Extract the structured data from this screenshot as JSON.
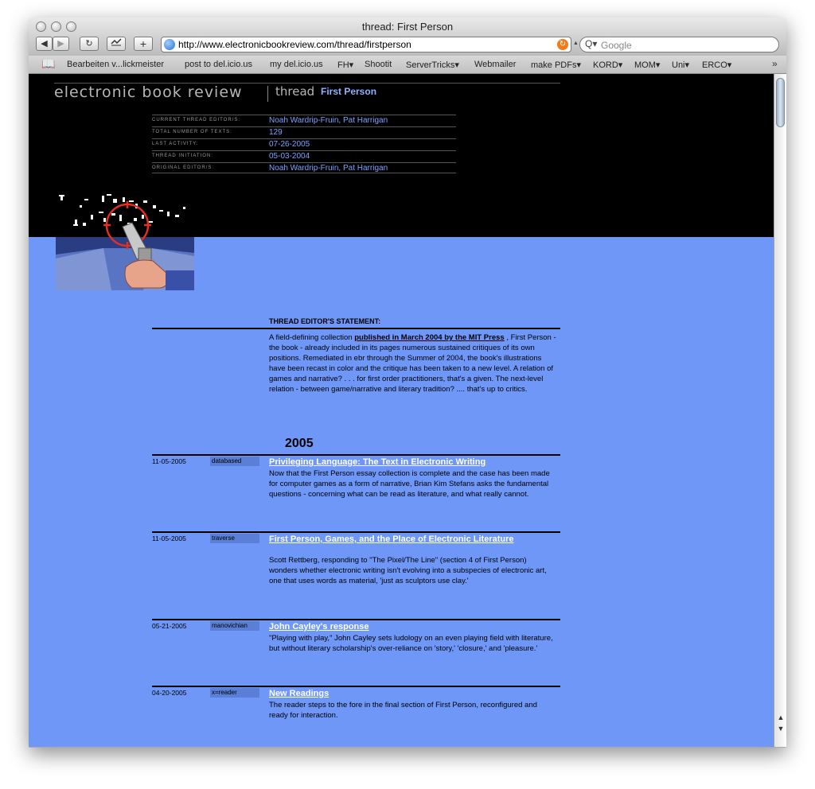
{
  "window": {
    "title": "thread: First Person",
    "url": "http://www.electronicbookreview.com/thread/firstperson",
    "search_placeholder": "Google"
  },
  "toolbar": {
    "back": "◀",
    "forward": "▶",
    "reload": "↻",
    "add": "+"
  },
  "bookmarks": [
    "Bearbeiten v...lickmeister",
    "post to del.icio.us",
    "my del.icio.us",
    "FH▾",
    "Shootit",
    "ServerTricks▾",
    "Webmailer",
    "make PDFs▾",
    "KORD▾",
    "MOM▾",
    "Uni▾",
    "ERCO▾"
  ],
  "site": {
    "name": "electronic book review",
    "thread_word": "thread",
    "thread_name": "First Person"
  },
  "thread_info": [
    {
      "label": "CURRENT THREAD EDITOR/S:",
      "value": "Noah Wardrip-Fruin, Pat Harrigan"
    },
    {
      "label": "TOTAL NUMBER OF TEXTS:",
      "value": "129"
    },
    {
      "label": "LAST ACTIVITY:",
      "value": "07-26-2005"
    },
    {
      "label": "THREAD INITIATION:",
      "value": "05-03-2004"
    },
    {
      "label": "ORIGINAL EDITOR/S:",
      "value": "Noah Wardrip-Fruin, Pat Harrigan"
    }
  ],
  "statement": {
    "heading": "THREAD EDITOR'S STATEMENT:",
    "before_link": "A field-defining collection ",
    "link": "published in March 2004 by the MIT Press",
    "after_link": " , First Person - the book - already included in its pages numerous sustained critiques of its own positions. Remediated in ebr through the Summer of 2004, the book's illustrations have been recast in color and the critique has been taken to a new level. A relation of games and narrative? . . . for first order practitioners, that's a given. The next-level relation - between game/narrative and literary tradition? .... that's up to critics."
  },
  "year": "2005",
  "entries": [
    {
      "date": "11-05-2005",
      "tag": "databased",
      "title": "Privileging Language: The Text in Electronic Writing",
      "desc": "Now that the First Person essay collection is complete and the case has been made for computer games as a form of narrative, Brian Kim Stefans asks the fundamental questions - concerning what can be read as literature, and what really cannot."
    },
    {
      "date": "11-05-2005",
      "tag": "traverse",
      "title": "First Person, Games, and the Place of Electronic Literature",
      "desc": "Scott Rettberg, responding to \"The Pixel/The Line\" (section 4 of First Person) wonders whether electronic writing isn't evolving into a subspecies of electronic art, one that uses words as material, 'just as sculptors use clay.'"
    },
    {
      "date": "05-21-2005",
      "tag": "manovichian",
      "title": "John Cayley's response",
      "desc": "\"Playing with play,\" John Cayley sets ludology on an even playing field with literature, but without literary scholarship's over-reliance on 'story,' 'closure,' and 'pleasure.'"
    },
    {
      "date": "04-20-2005",
      "tag": "x=reader",
      "title": "New Readings",
      "desc": "The reader steps to the fore in the final section of First Person, reconfigured and ready for interaction."
    }
  ],
  "colors": {
    "page_background": "#6f97f8",
    "header_background": "#000000",
    "accent_blue": "#7ea2ff",
    "tag_background": "#5b7fd6"
  }
}
